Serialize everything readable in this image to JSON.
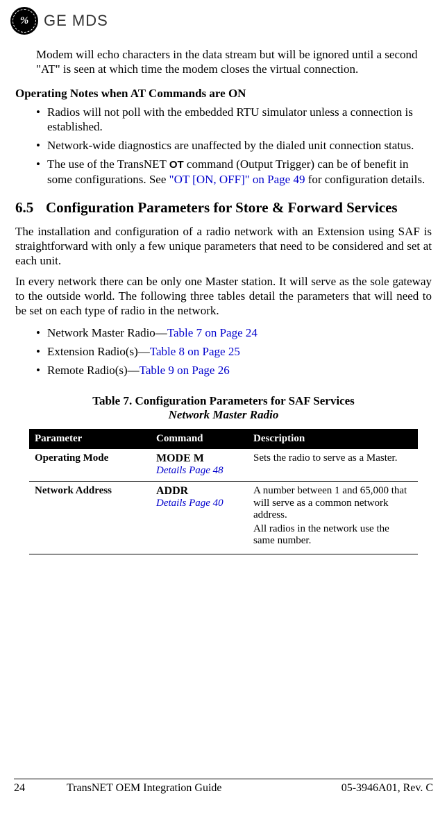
{
  "brand": {
    "logo_text": "%",
    "name": "GE MDS"
  },
  "intro_para": "Modem will echo characters in the data stream but will be ignored until a second \"AT\" is seen at which time the modem closes the virtual connection.",
  "subheading": "Operating Notes when AT Commands are ON",
  "bullets1": [
    {
      "text": "Radios will not poll with the embedded RTU simulator unless a connection is established."
    },
    {
      "text": "Network-wide diagnostics are unaffected by the dialed unit connection status."
    }
  ],
  "bullet3": {
    "prefix": "The use of the TransNET ",
    "cmd": "OT",
    "mid": " command (Output Trigger) can be of benefit in some configurations. See ",
    "link": "\"OT [ON, OFF]\" on Page 49",
    "suffix": " for configuration details."
  },
  "section": {
    "num": "6.5",
    "title": "Configuration Parameters for Store & Forward Services"
  },
  "sec_para1": "The installation and configuration of a radio network with an Extension using SAF is straightforward with only a few unique parameters that need to be considered and set at each unit.",
  "sec_para2": "In every network there can be only one Master station. It will serve as the sole gateway to the outside world. The following three tables detail the parameters that will need to be set on each type of radio in the network.",
  "bullets2": [
    {
      "label": "Network Master Radio—",
      "link": "Table 7 on Page 24"
    },
    {
      "label": "Extension Radio(s)—",
      "link": "Table 8 on Page 25"
    },
    {
      "label": "Remote Radio(s)—",
      "link": "Table 9 on Page 26"
    }
  ],
  "table": {
    "caption": "Table 7. Configuration Parameters for SAF Services",
    "subcaption": "Network Master Radio",
    "headers": {
      "p": "Parameter",
      "c": "Command",
      "d": "Description"
    },
    "rows": [
      {
        "param": "Operating Mode",
        "cmd": "MODE M",
        "details": "Details Page 48",
        "desc1": "Sets the radio to serve as a Master.",
        "desc2": ""
      },
      {
        "param": "Network Address",
        "cmd": "ADDR",
        "details": "Details Page 40",
        "desc1": "A number between 1 and 65,000 that will serve as a common network address.",
        "desc2": "All radios in the network use the same number."
      }
    ]
  },
  "footer": {
    "pagenum": "24",
    "title": "TransNET OEM Integration Guide",
    "docnum": "05-3946A01, Rev. C"
  }
}
